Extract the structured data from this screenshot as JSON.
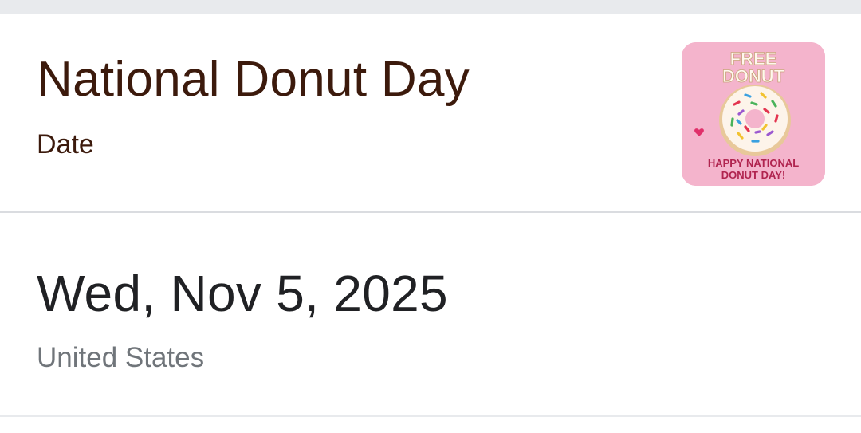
{
  "event": {
    "title": "National Donut Day",
    "type_label": "Date"
  },
  "thumbnail": {
    "line1": "FREE",
    "line2": "DONUT",
    "caption1": "HAPPY NATIONAL",
    "caption2": "DONUT DAY!",
    "background_color": "#f4b4cc"
  },
  "date_info": {
    "date": "Wed, Nov 5, 2025",
    "region": "United States"
  },
  "colors": {
    "title": "#3c1a0c",
    "date": "#202124",
    "region": "#70757a",
    "divider": "#dadce0"
  }
}
